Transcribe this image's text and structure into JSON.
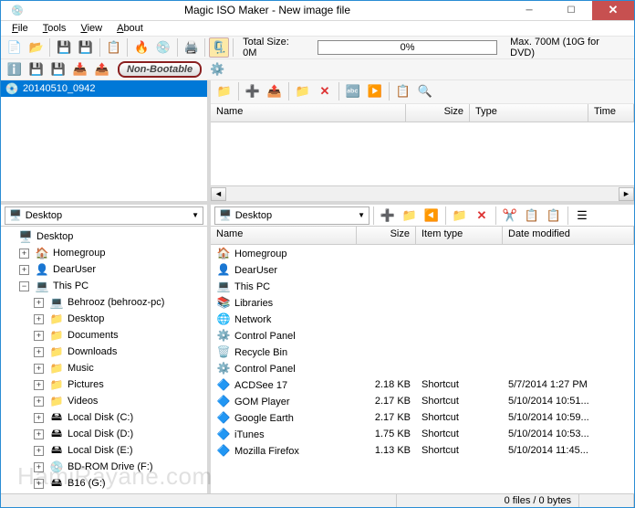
{
  "window": {
    "title": "Magic ISO Maker - New image file"
  },
  "menu": {
    "file": "File",
    "tools": "Tools",
    "view": "View",
    "about": "About"
  },
  "toolbar1": {
    "total_size_label": "Total Size: 0M",
    "progress_text": "0%",
    "max_label": "Max. 700M (10G for DVD)"
  },
  "toolbar2": {
    "boot_badge": "Non-Bootable"
  },
  "image_tree": {
    "root": "20140510_0942"
  },
  "image_list": {
    "cols": {
      "name": "Name",
      "size": "Size",
      "type": "Type",
      "time": "Time"
    }
  },
  "fs_path": "Desktop",
  "fs_tree": [
    {
      "label": "Desktop",
      "icon": "ic-desktop",
      "indent": 0,
      "exp": ""
    },
    {
      "label": "Homegroup",
      "icon": "ic-home",
      "indent": 1,
      "exp": "+"
    },
    {
      "label": "DearUser",
      "icon": "ic-user",
      "indent": 1,
      "exp": "+"
    },
    {
      "label": "This PC",
      "icon": "ic-pc",
      "indent": 1,
      "exp": "−"
    },
    {
      "label": "Behrooz (behrooz-pc)",
      "icon": "ic-pc",
      "indent": 2,
      "exp": "+"
    },
    {
      "label": "Desktop",
      "icon": "ic-folder",
      "indent": 2,
      "exp": "+"
    },
    {
      "label": "Documents",
      "icon": "ic-folder",
      "indent": 2,
      "exp": "+"
    },
    {
      "label": "Downloads",
      "icon": "ic-folder",
      "indent": 2,
      "exp": "+"
    },
    {
      "label": "Music",
      "icon": "ic-folder",
      "indent": 2,
      "exp": "+"
    },
    {
      "label": "Pictures",
      "icon": "ic-folder",
      "indent": 2,
      "exp": "+"
    },
    {
      "label": "Videos",
      "icon": "ic-folder",
      "indent": 2,
      "exp": "+"
    },
    {
      "label": "Local Disk (C:)",
      "icon": "ic-drive",
      "indent": 2,
      "exp": "+"
    },
    {
      "label": "Local Disk (D:)",
      "icon": "ic-drive",
      "indent": 2,
      "exp": "+"
    },
    {
      "label": "Local Disk (E:)",
      "icon": "ic-drive",
      "indent": 2,
      "exp": "+"
    },
    {
      "label": "BD-ROM Drive (F:)",
      "icon": "ic-disc",
      "indent": 2,
      "exp": "+"
    },
    {
      "label": "B16 (G:)",
      "icon": "ic-drive",
      "indent": 2,
      "exp": "+"
    }
  ],
  "fs_list": {
    "cols": {
      "name": "Name",
      "size": "Size",
      "itemtype": "Item type",
      "date": "Date modified"
    },
    "rows": [
      {
        "name": "Homegroup",
        "icon": "ic-home",
        "size": "",
        "type": "",
        "date": ""
      },
      {
        "name": "DearUser",
        "icon": "ic-user",
        "size": "",
        "type": "",
        "date": ""
      },
      {
        "name": "This PC",
        "icon": "ic-pc",
        "size": "",
        "type": "",
        "date": ""
      },
      {
        "name": "Libraries",
        "icon": "ic-lib",
        "size": "",
        "type": "",
        "date": ""
      },
      {
        "name": "Network",
        "icon": "ic-net",
        "size": "",
        "type": "",
        "date": ""
      },
      {
        "name": "Control Panel",
        "icon": "ic-cpl",
        "size": "",
        "type": "",
        "date": ""
      },
      {
        "name": "Recycle Bin",
        "icon": "ic-bin",
        "size": "",
        "type": "",
        "date": ""
      },
      {
        "name": "Control Panel",
        "icon": "ic-cpl",
        "size": "",
        "type": "",
        "date": ""
      },
      {
        "name": "ACDSee 17",
        "icon": "ic-app",
        "size": "2.18 KB",
        "type": "Shortcut",
        "date": "5/7/2014 1:27 PM"
      },
      {
        "name": "GOM Player",
        "icon": "ic-app",
        "size": "2.17 KB",
        "type": "Shortcut",
        "date": "5/10/2014 10:51..."
      },
      {
        "name": "Google Earth",
        "icon": "ic-app",
        "size": "2.17 KB",
        "type": "Shortcut",
        "date": "5/10/2014 10:59..."
      },
      {
        "name": "iTunes",
        "icon": "ic-app",
        "size": "1.75 KB",
        "type": "Shortcut",
        "date": "5/10/2014 10:53..."
      },
      {
        "name": "Mozilla Firefox",
        "icon": "ic-app",
        "size": "1.13 KB",
        "type": "Shortcut",
        "date": "5/10/2014 11:45..."
      }
    ]
  },
  "status": {
    "files": "0 files / 0 bytes"
  },
  "watermark": "HamiRayane.com"
}
